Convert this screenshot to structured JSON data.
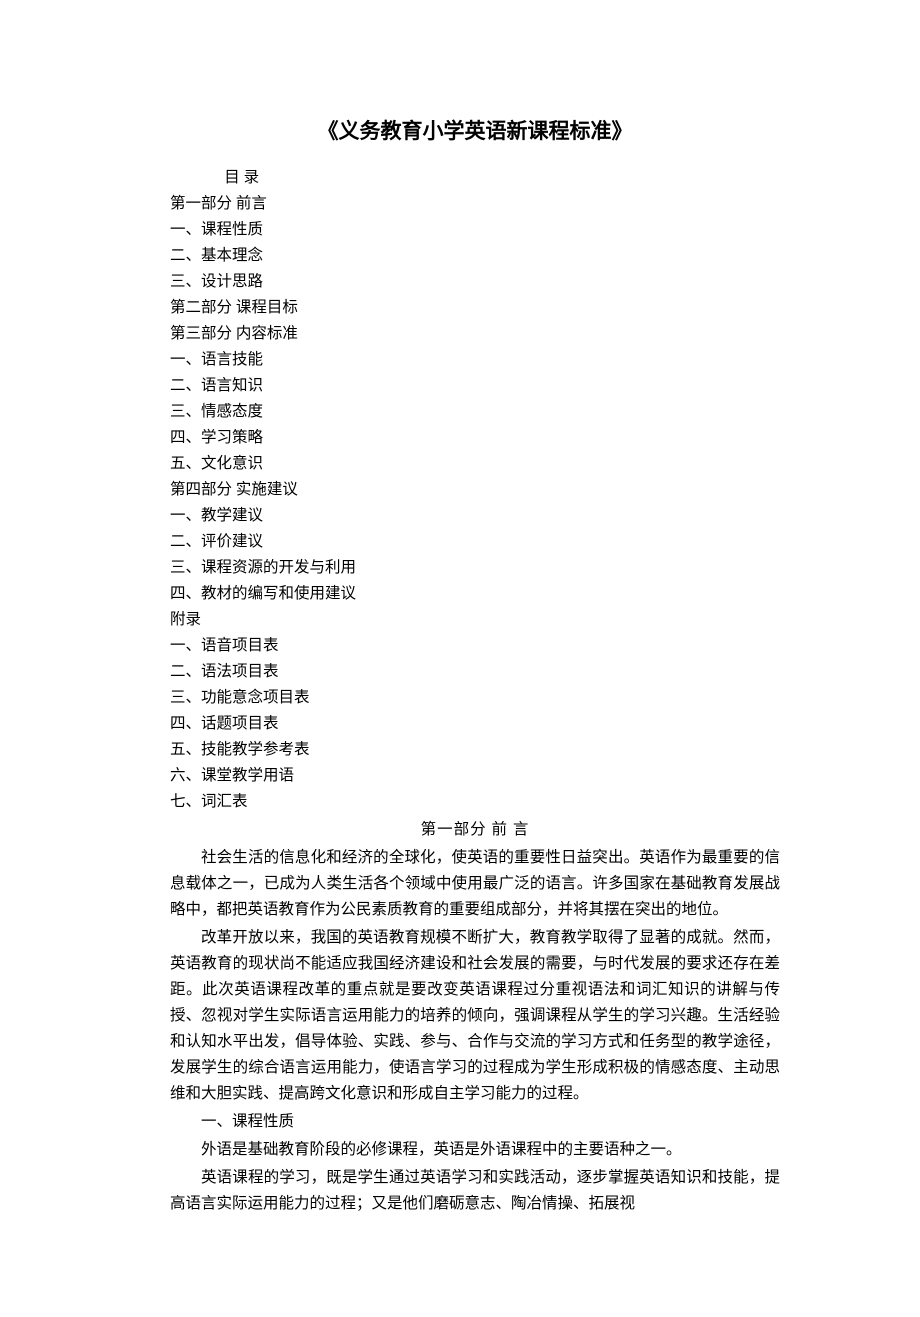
{
  "title": "《义务教育小学英语新课程标准》",
  "toc": {
    "heading": "目 录",
    "items": [
      "第一部分 前言",
      "一、课程性质",
      "二、基本理念",
      "三、设计思路",
      "第二部分 课程目标",
      "第三部分 内容标准",
      "一、语言技能",
      "二、语言知识",
      "三、情感态度",
      "四、学习策略",
      "五、文化意识",
      "第四部分 实施建议",
      "一、教学建议",
      "二、评价建议",
      "三、课程资源的开发与利用",
      "四、教材的编写和使用建议",
      "附录",
      "一、语音项目表",
      "二、语法项目表",
      "三、功能意念项目表",
      "四、话题项目表",
      "五、技能教学参考表",
      "六、课堂教学用语",
      "七、词汇表"
    ]
  },
  "section_header": "第一部分 前 言",
  "paragraphs": [
    "社会生活的信息化和经济的全球化，使英语的重要性日益突出。英语作为最重要的信息载体之一，已成为人类生活各个领域中使用最广泛的语言。许多国家在基础教育发展战略中，都把英语教育作为公民素质教育的重要组成部分，并将其摆在突出的地位。",
    "改革开放以来，我国的英语教育规模不断扩大，教育教学取得了显著的成就。然而，英语教育的现状尚不能适应我国经济建设和社会发展的需要，与时代发展的要求还存在差距。此次英语课程改革的重点就是要改变英语课程过分重视语法和词汇知识的讲解与传授、忽视对学生实际语言运用能力的培养的倾向，强调课程从学生的学习兴趣。生活经验和认知水平出发，倡导体验、实践、参与、合作与交流的学习方式和任务型的教学途径，发展学生的综合语言运用能力，使语言学习的过程成为学生形成积极的情感态度、主动思维和大胆实践、提高跨文化意识和形成自主学习能力的过程。"
  ],
  "sub_heading": "一、课程性质",
  "sub_paragraphs": [
    "外语是基础教育阶段的必修课程，英语是外语课程中的主要语种之一。",
    "英语课程的学习，既是学生通过英语学习和实践活动，逐步掌握英语知识和技能，提高语言实际运用能力的过程；又是他们磨砺意志、陶冶情操、拓展视"
  ]
}
